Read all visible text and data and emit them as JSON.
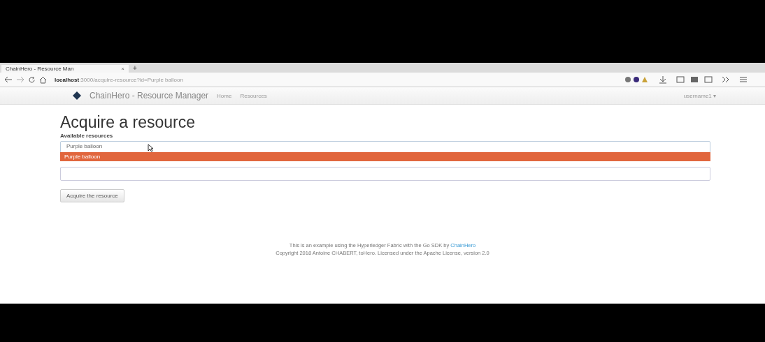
{
  "browser": {
    "tab_title": "ChainHero - Resource Man",
    "tab_close": "×",
    "new_tab": "+",
    "url_host": "localhost",
    "url_path": ":3000/acquire-resource?id=Purple balloon"
  },
  "navbar": {
    "brand": "ChainHero - Resource Manager",
    "links": [
      "Home",
      "Resources"
    ],
    "user": "username1 ▾"
  },
  "page": {
    "title": "Acquire a resource",
    "select_label": "Available resources",
    "select_value": "Purple balloon",
    "dropdown_options": [
      {
        "label": "Purple balloon",
        "selected": true
      }
    ],
    "button": "Acquire the resource"
  },
  "footer": {
    "line_1": "This is an example using the Hyperledger Fabric with the Go SDK by ",
    "link": "ChainHero",
    "line_2": "Copyright 2018 Antoine CHABERT, toHero. Licensed under the Apache License, version 2.0"
  }
}
